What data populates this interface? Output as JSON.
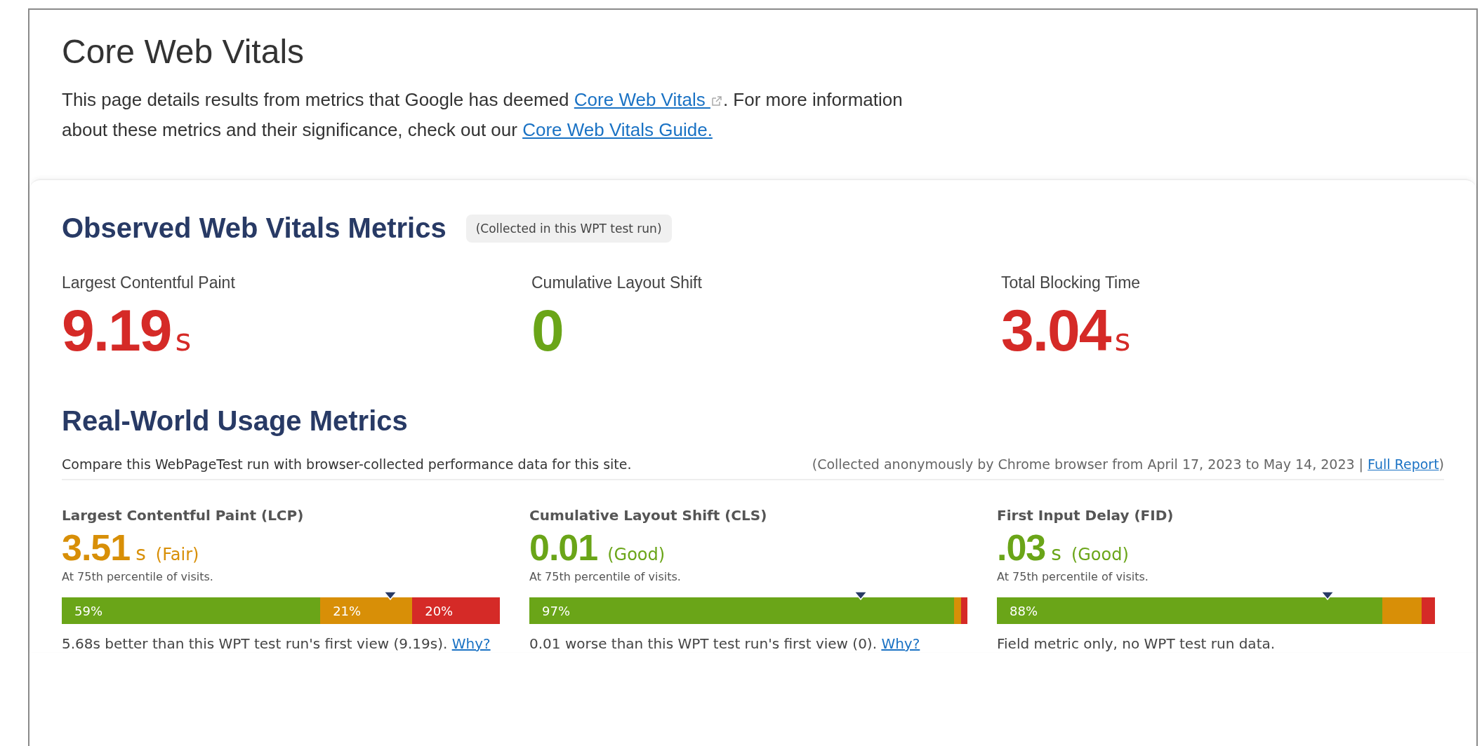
{
  "title": "Core Web Vitals",
  "intro": [
    {
      "kind": "text",
      "text": "This page details results from metrics that Google has deemed "
    },
    {
      "kind": "link",
      "text": "Core Web Vitals ",
      "external": true
    },
    {
      "kind": "text",
      "text": ". For more information about these metrics and their significance, check out our "
    },
    {
      "kind": "link",
      "text": "Core Web Vitals Guide.",
      "external": false
    }
  ],
  "observed": {
    "heading": "Observed Web Vitals Metrics",
    "badge": "(Collected in this WPT test run)",
    "metrics": [
      {
        "label": "Largest Contentful Paint",
        "value": "9.19",
        "unit": "s",
        "color": "#d52a27"
      },
      {
        "label": "Cumulative Layout Shift",
        "value": "0",
        "color": "#6aa518"
      },
      {
        "label": "Total Blocking Time",
        "value": "3.04",
        "unit": "s",
        "color": "#d52a27"
      }
    ]
  },
  "real_world": {
    "heading": "Real-World Usage Metrics",
    "description": "Compare this WebPageTest run with browser-collected performance data for this site.",
    "source": [
      {
        "kind": "text",
        "text": "(Collected anonymously by Chrome browser from April 17, 2023 to May 14, 2023 | "
      },
      {
        "kind": "link",
        "text": "Full Report"
      },
      {
        "kind": "text",
        "text": ")"
      }
    ],
    "metrics": [
      {
        "label": "Largest Contentful Paint (LCP)",
        "value": "3.51",
        "unit": "s",
        "verdict": "(Fair)",
        "color": "#d88f07",
        "percentile": "At 75th percentile of visits.",
        "segments": [
          {
            "color": "#6aa518",
            "label": "59%"
          },
          {
            "color": "#d88f07",
            "label": "21%"
          },
          {
            "color": "#d52a27",
            "label": "20%"
          }
        ],
        "note": "5.68s better than this WPT test run's first view (9.19s).",
        "link": "Why?"
      },
      {
        "label": "Cumulative Layout Shift (CLS)",
        "value": "0.01",
        "verdict": "(Good)",
        "color": "#6aa518",
        "percentile": "At 75th percentile of visits.",
        "segments": [
          {
            "color": "#6aa518",
            "label": "97%"
          },
          {
            "color": "#d88f07"
          },
          {
            "color": "#d52a27"
          }
        ],
        "note": "0.01 worse than this WPT test run's first view (0).",
        "link": "Why?"
      },
      {
        "label": "First Input Delay (FID)",
        "value": ".03",
        "unit": "s",
        "verdict": "(Good)",
        "color": "#6aa518",
        "percentile": "At 75th percentile of visits.",
        "segments": [
          {
            "color": "#6aa518",
            "label": "88%"
          },
          {
            "color": "#d88f07"
          },
          {
            "color": "#d52a27"
          }
        ],
        "note": "Field metric only, no WPT test run data."
      }
    ]
  }
}
